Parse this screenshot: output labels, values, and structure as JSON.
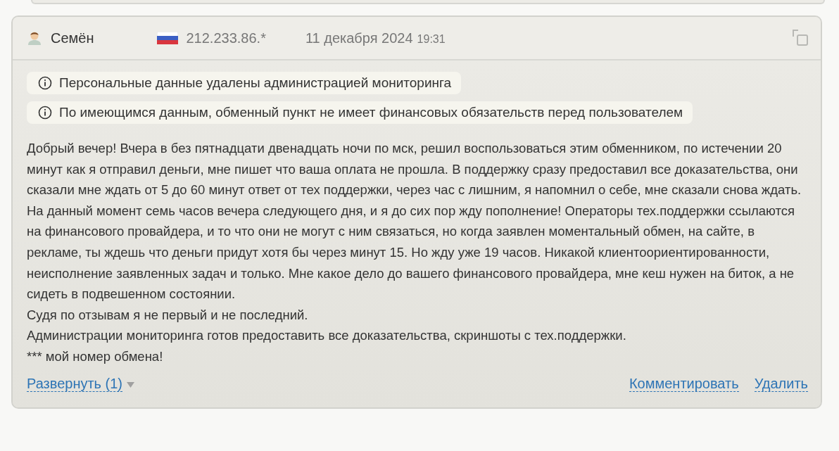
{
  "review": {
    "author": "Семён",
    "ip": "212.233.86.*",
    "date": "11 декабря 2024",
    "time": "19:31",
    "notices": [
      "Персональные данные удалены администрацией мониторинга",
      "По имеющимся данным, обменный пункт не имеет финансовых обязательств перед пользователем"
    ],
    "paragraphs": [
      "Добрый вечер! Вчера в без пятнадцати двенадцать ночи по мск, решил воспользоваться этим обменником, по истечении 20 минут как я отправил деньги, мне пишет что ваша оплата не прошла. В поддержку сразу предоставил все доказательства, они сказали мне ждать от 5 до 60 минут ответ от тех поддержки, через час с лишним, я напомнил о себе, мне сказали снова ждать. На данный момент семь часов вечера следующего дня, и я до сих пор жду пополнение! Операторы тех.поддержки ссылаются на финансового провайдера, и то что они не могут с ним связаться, но когда заявлен моментальный обмен, на сайте, в рекламе, ты ждешь что деньги придут хотя бы через минут 15. Но жду уже 19 часов. Никакой клиентоориентированности, неисполнение заявленных задач и только. Мне какое дело до вашего финансового провайдера, мне кеш нужен на биток, а не сидеть в подвешенном состоянии.",
      "Судя по отзывам я не первый и не последний.",
      "Администрации мониторинга готов предоставить все доказательства, скриншоты с тех.поддержки.",
      "*** мой номер обмена!"
    ],
    "expand_link": "Развернуть (1)",
    "actions": [
      "Комментировать",
      "Удалить"
    ]
  }
}
